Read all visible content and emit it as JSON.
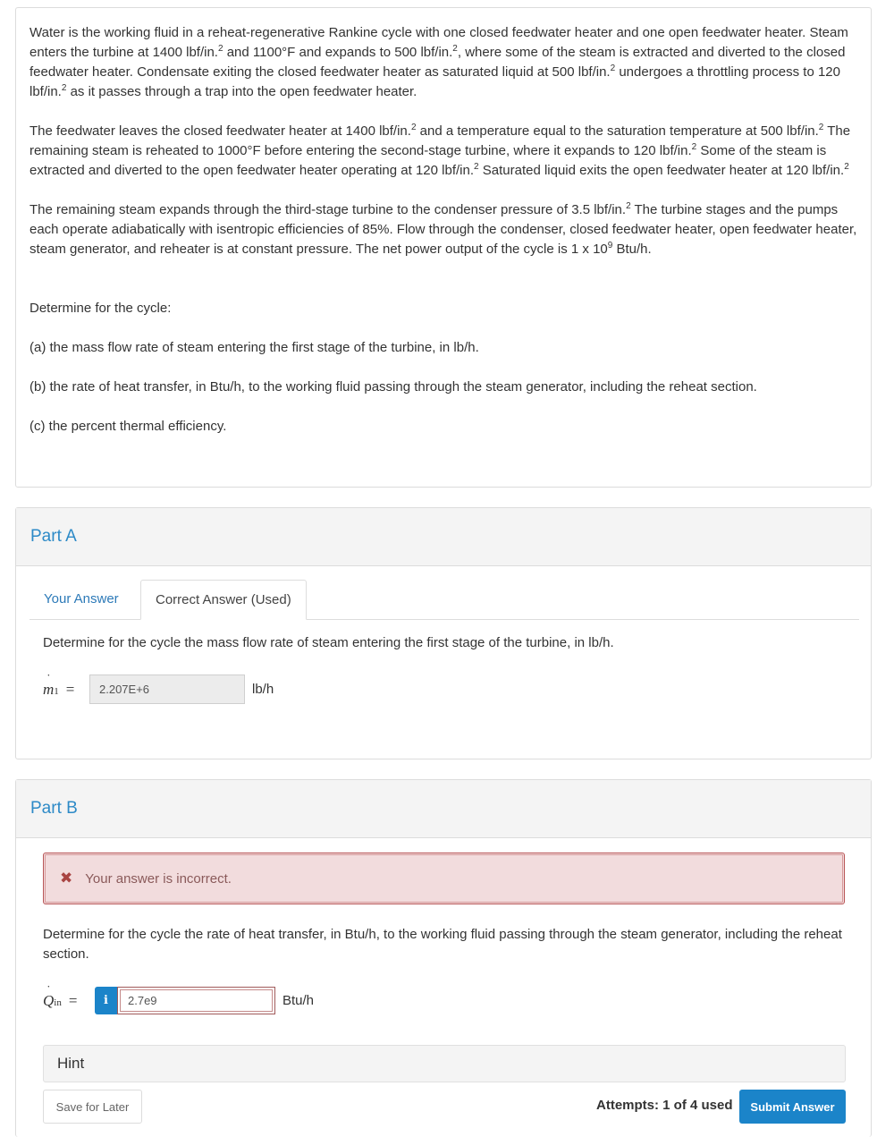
{
  "problem": {
    "paragraph1": {
      "parts": [
        "Water is the working fluid in a reheat-regenerative Rankine cycle with one closed feedwater heater and one open feedwater heater. Steam enters the turbine at 1400 lbf/in.",
        " and 1100°F and expands to 500 lbf/in.",
        ", where some of the steam is extracted and diverted to the closed feedwater heater. Condensate exiting the closed feedwater heater as saturated liquid at 500 lbf/in.",
        " undergoes a throttling process to 120 lbf/in.",
        " as it passes through a trap into the open feedwater heater."
      ]
    },
    "paragraph2": {
      "parts": [
        "The feedwater leaves the closed feedwater heater at 1400 lbf/in.",
        " and a temperature equal to the saturation temperature at 500 lbf/in.",
        " The remaining steam is reheated to 1000°F before entering the second-stage turbine, where it expands to 120 lbf/in.",
        " Some of the steam is extracted and diverted to the open feedwater heater operating at 120 lbf/in.",
        " Saturated liquid exits the open feedwater heater at 120 lbf/in.",
        ""
      ]
    },
    "paragraph3": {
      "parts": [
        "The remaining steam expands through the third-stage turbine to the condenser pressure of 3.5 lbf/in.",
        " The turbine stages and the pumps each operate adiabatically with isentropic efficiencies of 85%. Flow through the condenser, closed feedwater heater, open feedwater heater, steam generator, and reheater is at constant pressure. The net power output of the cycle is 1 x 10",
        " Btu/h."
      ]
    },
    "superscript_2": "2",
    "superscript_9": "9",
    "determine": "Determine for the cycle:",
    "items": [
      "(a) the mass flow rate of steam entering the first stage of the turbine, in lb/h.",
      "(b) the rate of heat transfer, in Btu/h, to the working fluid passing through the steam generator, including the reheat section.",
      "(c) the percent thermal efficiency."
    ]
  },
  "partA": {
    "title": "Part A",
    "tabs": [
      {
        "label": "Your Answer",
        "active": false
      },
      {
        "label": "Correct Answer (Used)",
        "active": true
      }
    ],
    "question": "Determine for the cycle the mass flow rate of steam entering the first stage of the turbine, in lb/h.",
    "variable": {
      "symbol": "m",
      "subscript": "1",
      "equals": "="
    },
    "value": "2.207E+6",
    "unit": "lb/h"
  },
  "partB": {
    "title": "Part B",
    "alert": {
      "icon": "x-icon",
      "glyph": "✖",
      "message": "Your answer is incorrect.",
      "color": "#a94442"
    },
    "question": "Determine for the cycle the rate of heat transfer, in Btu/h, to the working fluid passing through the steam generator, including the reheat section.",
    "variable": {
      "symbol": "Q",
      "subscript": "in",
      "equals": "="
    },
    "info_glyph": "i",
    "value": "2.7e9",
    "unit": "Btu/h",
    "hint_label": "Hint",
    "save_label": "Save for Later",
    "attempts": "Attempts: 1 of 4 used",
    "submit_label": "Submit Answer"
  },
  "colors": {
    "accent": "#1b84c9",
    "part_title": "#2d8ac7",
    "error_bg": "#f2dcdd",
    "error_border": "#b85556"
  }
}
